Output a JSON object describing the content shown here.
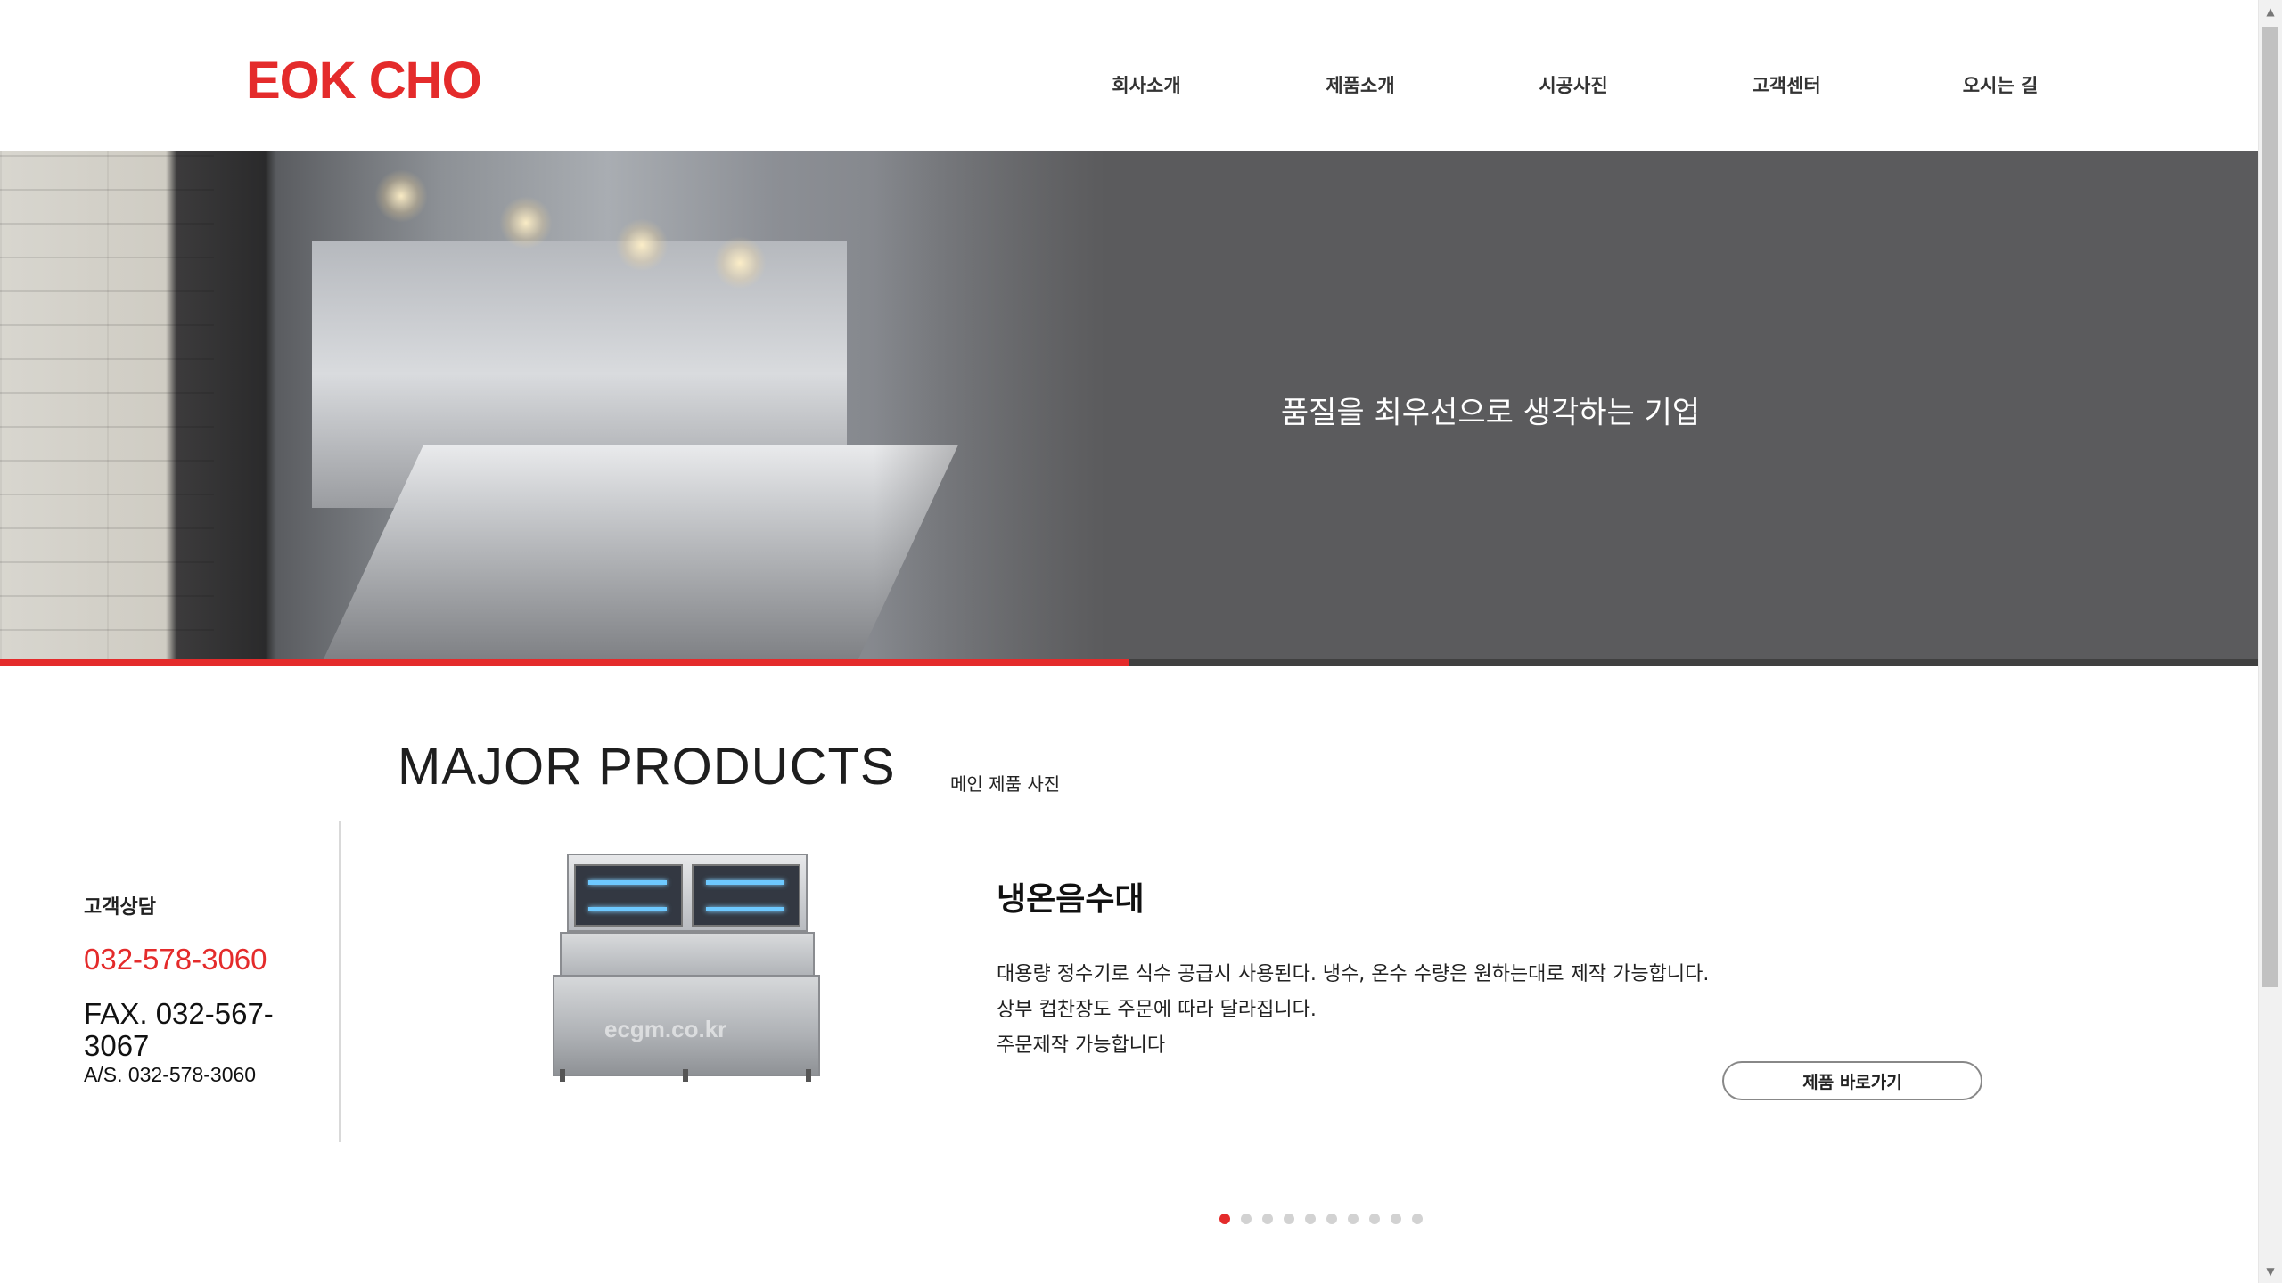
{
  "brand": {
    "logo": "EOK CHO",
    "color": "#e42b2b"
  },
  "nav": {
    "items": [
      {
        "label": "회사소개"
      },
      {
        "label": "제품소개"
      },
      {
        "label": "시공사진"
      },
      {
        "label": "고객센터"
      },
      {
        "label": "오시는 길"
      }
    ]
  },
  "hero": {
    "caption": "품질을 최우선으로 생각하는 기업",
    "progress": 0.5
  },
  "section": {
    "title": "MAJOR PRODUCTS",
    "subtitle": "메인 제품 사진"
  },
  "contact": {
    "heading": "고객상담",
    "phone": "032-578-3060",
    "fax": "FAX. 032-567-3067",
    "as": "A/S. 032-578-3060"
  },
  "product": {
    "image_watermark": "ecgm.co.kr",
    "name": "냉온음수대",
    "description": [
      "대용량 정수기로 식수 공급시 사용된다. 냉수, 온수 수량은 원하는대로 제작 가능합니다.",
      "상부 컵찬장도 주문에 따라 달라집니다.",
      "주문제작 가능합니다"
    ],
    "button_label": "제품 바로가기"
  },
  "carousel": {
    "total": 10,
    "active": 1
  },
  "colors": {
    "accent": "#e42b2b",
    "hero_bg": "#5b5b5d"
  }
}
